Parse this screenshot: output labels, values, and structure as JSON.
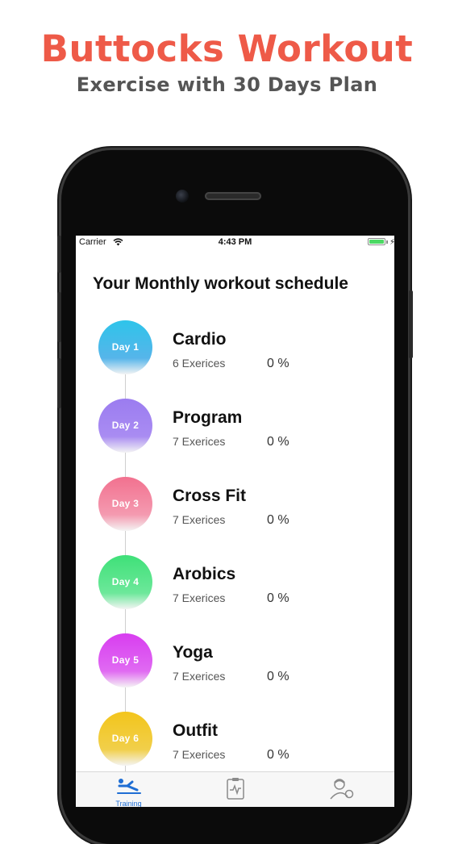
{
  "promo": {
    "title": "Buttocks Workout",
    "subtitle": "Exercise with 30 Days Plan",
    "title_color": "#ee5a48"
  },
  "status_bar": {
    "carrier": "Carrier",
    "time": "4:43 PM",
    "battery_color": "#4cd964"
  },
  "screen": {
    "title": "Your Monthly workout schedule"
  },
  "days": [
    {
      "day": "Day 1",
      "name": "Cardio",
      "count": "6 Exerices",
      "percent": "0 %",
      "color_top": "#2ec4ea",
      "color_bottom": "#56b5ea"
    },
    {
      "day": "Day 2",
      "name": "Program",
      "count": "7 Exerices",
      "percent": "0 %",
      "color_top": "#9b7cf0",
      "color_bottom": "#a98cf2"
    },
    {
      "day": "Day 3",
      "name": "Cross Fit",
      "count": "7 Exerices",
      "percent": "0 %",
      "color_top": "#f2718f",
      "color_bottom": "#f49ab0"
    },
    {
      "day": "Day 4",
      "name": "Arobics",
      "count": "7 Exerices",
      "percent": "0 %",
      "color_top": "#3fe078",
      "color_bottom": "#6ce89a"
    },
    {
      "day": "Day 5",
      "name": "Yoga",
      "count": "7 Exerices",
      "percent": "0 %",
      "color_top": "#d83df0",
      "color_bottom": "#e06af2"
    },
    {
      "day": "Day 6",
      "name": "Outfit",
      "count": "7 Exerices",
      "percent": "0 %",
      "color_top": "#f3c51c",
      "color_bottom": "#f1cf4a"
    }
  ],
  "tabs": [
    {
      "icon": "workout-icon",
      "label": "Training",
      "active": true
    },
    {
      "icon": "clipboard-icon",
      "label": "",
      "active": false
    },
    {
      "icon": "trainer-icon",
      "label": "",
      "active": false
    }
  ]
}
